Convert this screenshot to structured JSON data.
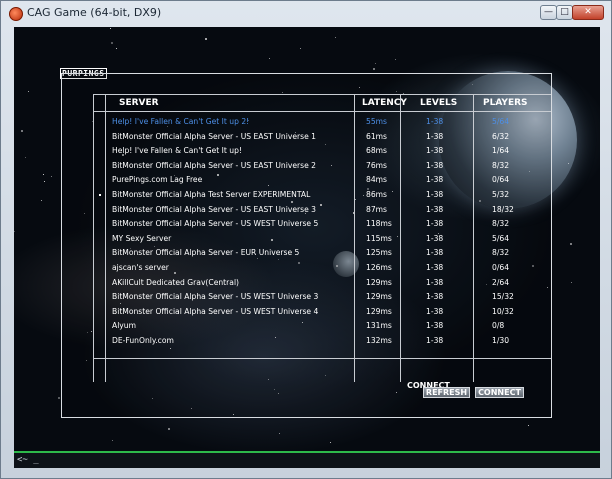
{
  "window": {
    "title": "CAG Game (64-bit, DX9)",
    "minimize": "—",
    "maximize": "□",
    "close": "✕"
  },
  "screen": {
    "title": "PURPINGS"
  },
  "columns": {
    "server": "SERVER",
    "latency": "LATENCY",
    "levels": "LEVELS",
    "players": "PLAYERS"
  },
  "servers": [
    {
      "name": "Help! I've Fallen & Can't Get It up 2!",
      "latency": "55ms",
      "levels": "1-38",
      "players": "5/64",
      "selected": true
    },
    {
      "name": "BitMonster Official Alpha Server - US EAST Universe 1",
      "latency": "61ms",
      "levels": "1-38",
      "players": "6/32"
    },
    {
      "name": "Help! I've Fallen & Can't Get It up!",
      "latency": "68ms",
      "levels": "1-38",
      "players": "1/64"
    },
    {
      "name": "BitMonster Official Alpha Server - US EAST Universe 2",
      "latency": "76ms",
      "levels": "1-38",
      "players": "8/32"
    },
    {
      "name": "PurePings.com Lag Free",
      "latency": "84ms",
      "levels": "1-38",
      "players": "0/64"
    },
    {
      "name": "BitMonster Official Alpha Test Server EXPERIMENTAL",
      "latency": "86ms",
      "levels": "1-38",
      "players": "5/32"
    },
    {
      "name": "BitMonster Official Alpha Server - US EAST Universe 3",
      "latency": "87ms",
      "levels": "1-38",
      "players": "18/32"
    },
    {
      "name": "BitMonster Official Alpha Server - US WEST Universe 5",
      "latency": "118ms",
      "levels": "1-38",
      "players": "8/32"
    },
    {
      "name": "MY Sexy Server",
      "latency": "115ms",
      "levels": "1-38",
      "players": "5/64"
    },
    {
      "name": "BitMonster Official Alpha Server - EUR Universe 5",
      "latency": "125ms",
      "levels": "1-38",
      "players": "8/32"
    },
    {
      "name": "ajscan's server",
      "latency": "126ms",
      "levels": "1-38",
      "players": "0/64"
    },
    {
      "name": "AKillCult Dedicated Grav(Central)",
      "latency": "129ms",
      "levels": "1-38",
      "players": "2/64"
    },
    {
      "name": "BitMonster Official Alpha Server - US WEST Universe 3",
      "latency": "129ms",
      "levels": "1-38",
      "players": "15/32"
    },
    {
      "name": "BitMonster Official Alpha Server - US WEST Universe 4",
      "latency": "129ms",
      "levels": "1-38",
      "players": "10/32"
    },
    {
      "name": "Alyum",
      "latency": "131ms",
      "levels": "1-38",
      "players": "0/8"
    },
    {
      "name": "DE-FunOnly.com",
      "latency": "132ms",
      "levels": "1-38",
      "players": "1/30"
    }
  ],
  "actions": {
    "connect_label": "CONNECT",
    "refresh": "REFRESH",
    "connect": "CONNECT"
  },
  "console": {
    "prompt": "<~ _"
  }
}
